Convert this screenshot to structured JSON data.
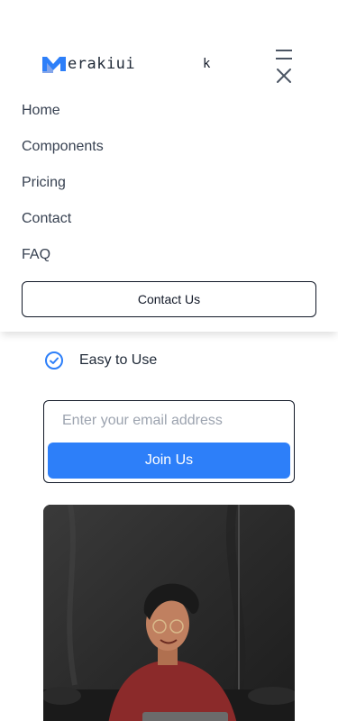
{
  "header": {
    "brand_text": "erakiui",
    "brand_icon": "merakiui-logo-icon",
    "stray_text": "k",
    "menu_icons": [
      "hamburger-icon",
      "close-icon"
    ]
  },
  "nav": {
    "items": [
      {
        "label": "Home"
      },
      {
        "label": "Components"
      },
      {
        "label": "Pricing"
      },
      {
        "label": "Contact"
      },
      {
        "label": "FAQ"
      }
    ],
    "cta_label": "Contact Us"
  },
  "feature": {
    "icon": "check-circle-icon",
    "label": "Easy to Use"
  },
  "signup": {
    "email_placeholder": "Enter your email address",
    "email_value": "",
    "button_label": "Join Us"
  },
  "colors": {
    "brand": "#2d7ff9",
    "text": "#1f2937",
    "border": "#111827"
  }
}
